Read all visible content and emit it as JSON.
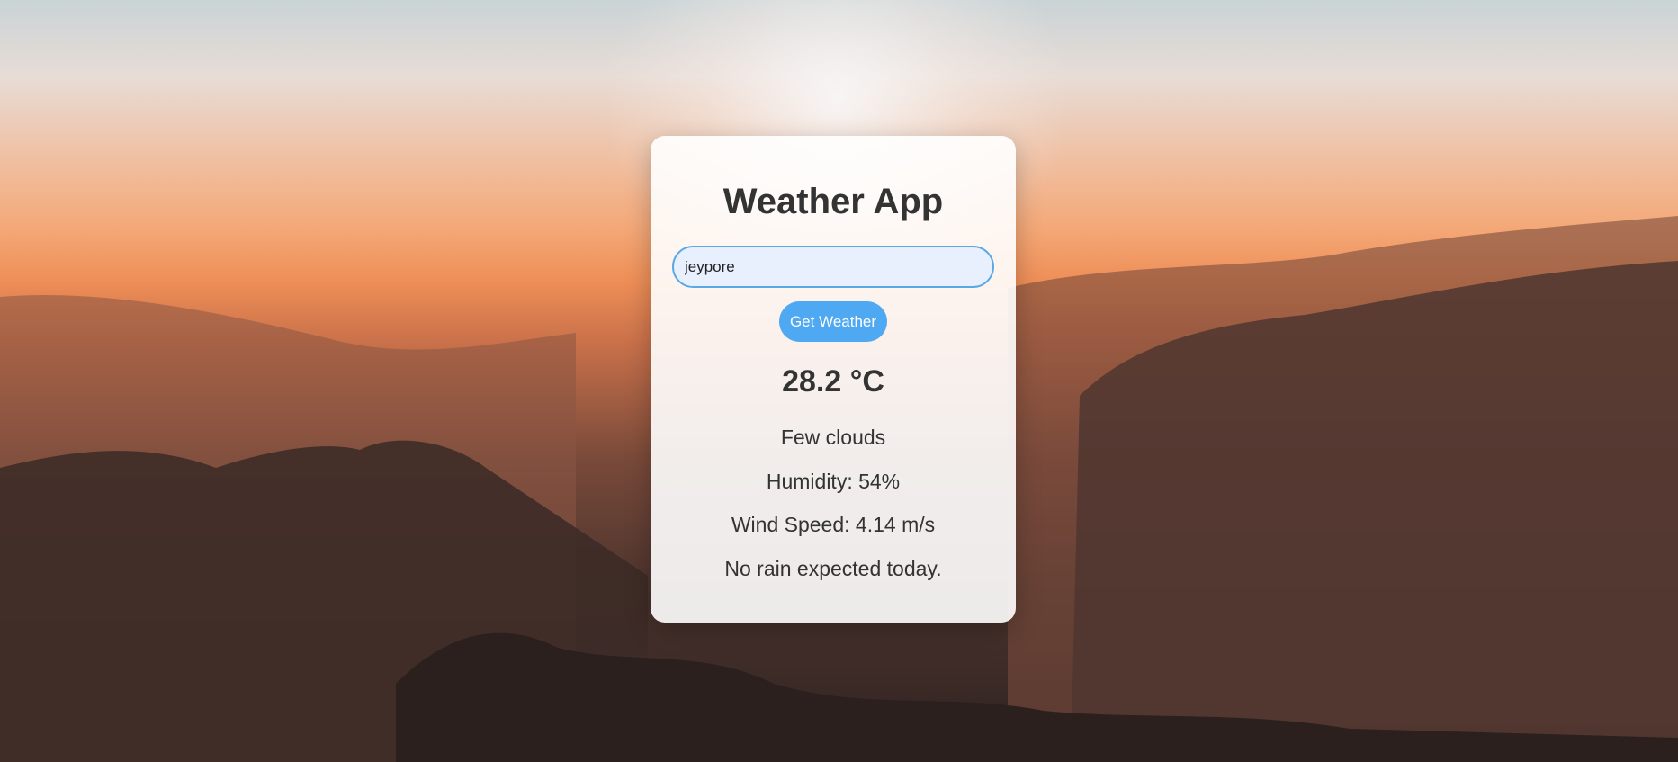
{
  "app": {
    "title": "Weather App"
  },
  "search": {
    "value": "jeypore",
    "button_label": "Get Weather"
  },
  "weather": {
    "temperature": "28.2 °C",
    "description": "Few clouds",
    "humidity": "Humidity: 54%",
    "wind_speed": "Wind Speed: 4.14 m/s",
    "rain_forecast": "No rain expected today."
  },
  "colors": {
    "accent": "#4fa9f2",
    "input_border": "#5aa9e6",
    "input_background": "#e8f0fe",
    "text": "#333333"
  }
}
